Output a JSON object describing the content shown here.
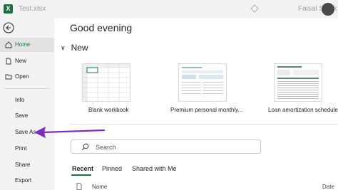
{
  "app": {
    "logo_letter": "X",
    "file_name": "Test.xlsx"
  },
  "account": {
    "user_name": "Faisal Shaik"
  },
  "sidebar": {
    "items": [
      {
        "label": "Home",
        "icon": "home-icon",
        "active": true
      },
      {
        "label": "New",
        "icon": "new-file-icon"
      },
      {
        "label": "Open",
        "icon": "open-folder-icon"
      },
      {
        "label": "Info"
      },
      {
        "label": "Save"
      },
      {
        "label": "Save As"
      },
      {
        "label": "Print"
      },
      {
        "label": "Share"
      },
      {
        "label": "Export"
      }
    ]
  },
  "main": {
    "greeting": "Good evening",
    "new_section": {
      "title": "New"
    },
    "templates": [
      {
        "label": "Blank workbook"
      },
      {
        "label": "Premium personal monthly..."
      },
      {
        "label": "Loan amortization schedule"
      }
    ],
    "search": {
      "placeholder": "Search"
    },
    "tabs": [
      {
        "label": "Recent",
        "active": true
      },
      {
        "label": "Pinned"
      },
      {
        "label": "Shared with Me"
      }
    ],
    "file_list": {
      "columns": [
        "Name",
        "Date"
      ]
    }
  },
  "annotation": {
    "color": "#7b2fbf",
    "target": "Save As"
  },
  "colors": {
    "accent": "#1a7a3e",
    "excel_green": "#1d6f42"
  }
}
